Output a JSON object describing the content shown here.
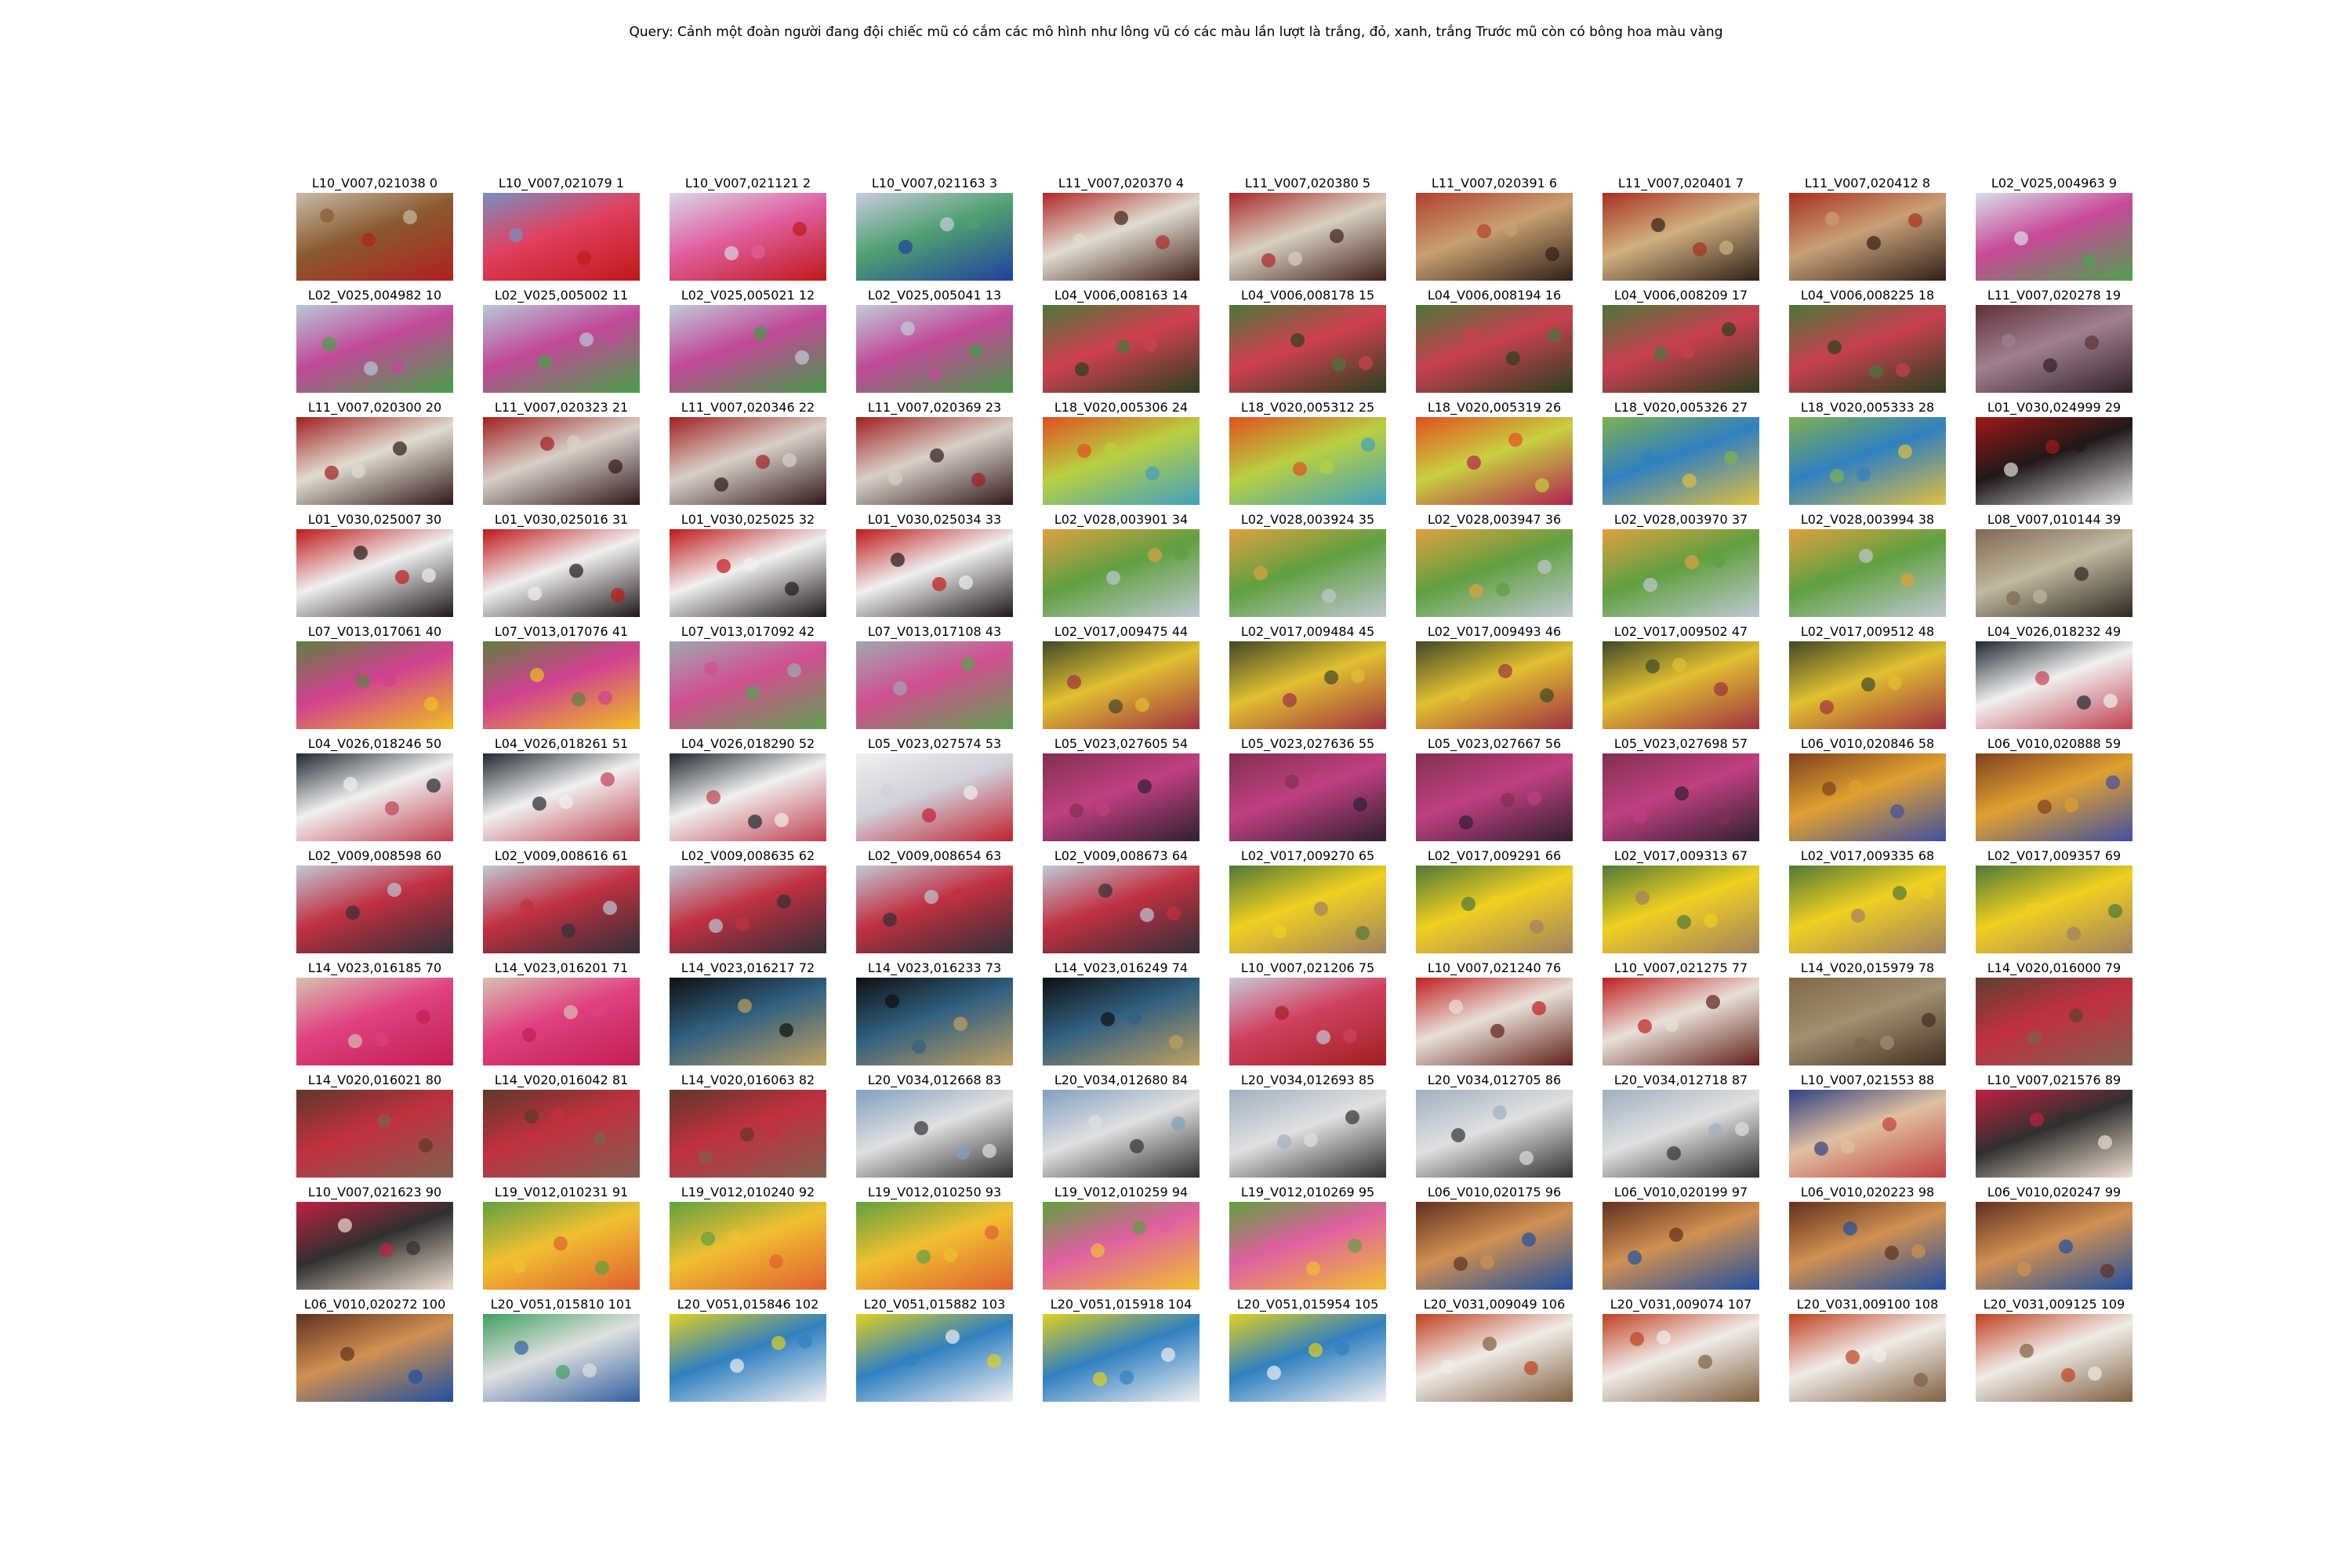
{
  "query": "Query: Cảnh một đoàn người đang đội chiếc mũ có cắm các mô hình như lông vũ có các màu lần lượt là trắng, đỏ, xanh, trắng Trước mũ còn có bông hoa màu vàng",
  "results": [
    {
      "label": "L10_V007,021038 0",
      "colors": [
        "#c8bca8",
        "#8a5a30",
        "#b02020"
      ]
    },
    {
      "label": "L10_V007,021079 1",
      "colors": [
        "#7890c0",
        "#e04060",
        "#c01818"
      ]
    },
    {
      "label": "L10_V007,021121 2",
      "colors": [
        "#d8d8e8",
        "#e060a0",
        "#c01818"
      ]
    },
    {
      "label": "L10_V007,021163 3",
      "colors": [
        "#c8cce0",
        "#50a070",
        "#2040a0"
      ]
    },
    {
      "label": "L11_V007,020370 4",
      "colors": [
        "#b02828",
        "#e0dcd0",
        "#402018"
      ]
    },
    {
      "label": "L11_V007,020380 5",
      "colors": [
        "#a82828",
        "#d8d0c0",
        "#402018"
      ]
    },
    {
      "label": "L11_V007,020391 6",
      "colors": [
        "#b04030",
        "#c8a070",
        "#302018"
      ]
    },
    {
      "label": "L11_V007,020401 7",
      "colors": [
        "#a83020",
        "#d0b080",
        "#302018"
      ]
    },
    {
      "label": "L11_V007,020412 8",
      "colors": [
        "#a83020",
        "#c8a078",
        "#302018"
      ]
    },
    {
      "label": "L02_V025,004963 9",
      "colors": [
        "#d8e0e8",
        "#c84898",
        "#50a050"
      ]
    },
    {
      "label": "L02_V025,004982 10",
      "colors": [
        "#b8c8d8",
        "#c04898",
        "#48a048"
      ]
    },
    {
      "label": "L02_V025,005002 11",
      "colors": [
        "#b8c8d8",
        "#c04898",
        "#48a048"
      ]
    },
    {
      "label": "L02_V025,005021 12",
      "colors": [
        "#c0ccd8",
        "#c04898",
        "#489848"
      ]
    },
    {
      "label": "L02_V025,005041 13",
      "colors": [
        "#c0ccd8",
        "#c04898",
        "#489848"
      ]
    },
    {
      "label": "L04_V006,008163 14",
      "colors": [
        "#4a7838",
        "#d04050",
        "#2a4020"
      ]
    },
    {
      "label": "L04_V006,008178 15",
      "colors": [
        "#4a7838",
        "#d04050",
        "#2a4020"
      ]
    },
    {
      "label": "L04_V006,008194 16",
      "colors": [
        "#4a7838",
        "#c84050",
        "#2a4020"
      ]
    },
    {
      "label": "L04_V006,008209 17",
      "colors": [
        "#4a7838",
        "#c84050",
        "#2a4020"
      ]
    },
    {
      "label": "L04_V006,008225 18",
      "colors": [
        "#4a7838",
        "#c84050",
        "#2a4020"
      ]
    },
    {
      "label": "L11_V007,020278 19",
      "colors": [
        "#603038",
        "#a08090",
        "#302028"
      ]
    },
    {
      "label": "L11_V007,020300 20",
      "colors": [
        "#a02020",
        "#e0dcd0",
        "#301818"
      ]
    },
    {
      "label": "L11_V007,020323 21",
      "colors": [
        "#a02020",
        "#d8d0c8",
        "#301818"
      ]
    },
    {
      "label": "L11_V007,020346 22",
      "colors": [
        "#a02020",
        "#d8d0c8",
        "#301818"
      ]
    },
    {
      "label": "L11_V007,020369 23",
      "colors": [
        "#a02020",
        "#d8d0c8",
        "#301818"
      ]
    },
    {
      "label": "L18_V020,005306 24",
      "colors": [
        "#e05020",
        "#b8d040",
        "#40a0c0"
      ]
    },
    {
      "label": "L18_V020,005312 25",
      "colors": [
        "#e05020",
        "#b8d040",
        "#40a0c0"
      ]
    },
    {
      "label": "L18_V020,005319 26",
      "colors": [
        "#e05020",
        "#c8d040",
        "#b02050"
      ]
    },
    {
      "label": "L18_V020,005326 27",
      "colors": [
        "#80b050",
        "#3080c0",
        "#e0c040"
      ]
    },
    {
      "label": "L18_V020,005333 28",
      "colors": [
        "#80b050",
        "#3080c0",
        "#e0c040"
      ]
    },
    {
      "label": "L01_V030,024999 29",
      "colors": [
        "#a01818",
        "#201818",
        "#e0e0e0"
      ]
    },
    {
      "label": "L01_V030,025007 30",
      "colors": [
        "#c01818",
        "#f0f0f0",
        "#201818"
      ]
    },
    {
      "label": "L01_V030,025016 31",
      "colors": [
        "#c01818",
        "#f0f0f0",
        "#201818"
      ]
    },
    {
      "label": "L01_V030,025025 32",
      "colors": [
        "#c01818",
        "#f0f0f0",
        "#201818"
      ]
    },
    {
      "label": "L01_V030,025034 33",
      "colors": [
        "#c01818",
        "#f0f0f0",
        "#201818"
      ]
    },
    {
      "label": "L02_V028,003901 34",
      "colors": [
        "#e0a040",
        "#60a040",
        "#c0c8d0"
      ]
    },
    {
      "label": "L02_V028,003924 35",
      "colors": [
        "#e0a040",
        "#60a040",
        "#c0c8d0"
      ]
    },
    {
      "label": "L02_V028,003947 36",
      "colors": [
        "#e0a040",
        "#60a040",
        "#c0c8d0"
      ]
    },
    {
      "label": "L02_V028,003970 37",
      "colors": [
        "#e0a040",
        "#60a040",
        "#c0c8d0"
      ]
    },
    {
      "label": "L02_V028,003994 38",
      "colors": [
        "#e0a040",
        "#60a040",
        "#c0c8d0"
      ]
    },
    {
      "label": "L08_V007,010144 39",
      "colors": [
        "#806850",
        "#c0b8a0",
        "#302820"
      ]
    },
    {
      "label": "L07_V013,017061 40",
      "colors": [
        "#608040",
        "#d04090",
        "#f0c020"
      ]
    },
    {
      "label": "L07_V013,017076 41",
      "colors": [
        "#608040",
        "#d04090",
        "#f0c020"
      ]
    },
    {
      "label": "L07_V013,017092 42",
      "colors": [
        "#a0a8b0",
        "#d05090",
        "#60a050"
      ]
    },
    {
      "label": "L07_V013,017108 43",
      "colors": [
        "#a0a8b0",
        "#d05090",
        "#60a050"
      ]
    },
    {
      "label": "L02_V017,009475 44",
      "colors": [
        "#404828",
        "#e0c030",
        "#a03040"
      ]
    },
    {
      "label": "L02_V017,009484 45",
      "colors": [
        "#404828",
        "#e0c030",
        "#a03040"
      ]
    },
    {
      "label": "L02_V017,009493 46",
      "colors": [
        "#404828",
        "#e0c030",
        "#a03040"
      ]
    },
    {
      "label": "L02_V017,009502 47",
      "colors": [
        "#404828",
        "#e0c030",
        "#a03040"
      ]
    },
    {
      "label": "L02_V017,009512 48",
      "colors": [
        "#404828",
        "#e0c030",
        "#a03040"
      ]
    },
    {
      "label": "L04_V026,018232 49",
      "colors": [
        "#202830",
        "#f0f0f0",
        "#c04050"
      ]
    },
    {
      "label": "L04_V026,018246 50",
      "colors": [
        "#202830",
        "#f0f0f0",
        "#c04050"
      ]
    },
    {
      "label": "L04_V026,018261 51",
      "colors": [
        "#202830",
        "#f0f0f0",
        "#c04050"
      ]
    },
    {
      "label": "L04_V026,018290 52",
      "colors": [
        "#202830",
        "#f0f0f0",
        "#c04050"
      ]
    },
    {
      "label": "L05_V023,027574 53",
      "colors": [
        "#f0f0f0",
        "#d0d0d8",
        "#c02030"
      ]
    },
    {
      "label": "L05_V023,027605 54",
      "colors": [
        "#803050",
        "#c04080",
        "#302030"
      ]
    },
    {
      "label": "L05_V023,027636 55",
      "colors": [
        "#803050",
        "#c04080",
        "#302030"
      ]
    },
    {
      "label": "L05_V023,027667 56",
      "colors": [
        "#803050",
        "#c04080",
        "#302030"
      ]
    },
    {
      "label": "L05_V023,027698 57",
      "colors": [
        "#803050",
        "#c04080",
        "#302030"
      ]
    },
    {
      "label": "L06_V010,020846 58",
      "colors": [
        "#804020",
        "#e0a030",
        "#4050a0"
      ]
    },
    {
      "label": "L06_V010,020888 59",
      "colors": [
        "#804020",
        "#e0a030",
        "#4050a0"
      ]
    },
    {
      "label": "L02_V009,008598 60",
      "colors": [
        "#c0c8d8",
        "#c03040",
        "#303038"
      ]
    },
    {
      "label": "L02_V009,008616 61",
      "colors": [
        "#c0c8d8",
        "#c03040",
        "#303038"
      ]
    },
    {
      "label": "L02_V009,008635 62",
      "colors": [
        "#c0c8d8",
        "#c03040",
        "#303038"
      ]
    },
    {
      "label": "L02_V009,008654 63",
      "colors": [
        "#c0c8d8",
        "#c03040",
        "#303038"
      ]
    },
    {
      "label": "L02_V009,008673 64",
      "colors": [
        "#c0c8d8",
        "#c03040",
        "#303038"
      ]
    },
    {
      "label": "L02_V017,009270 65",
      "colors": [
        "#507838",
        "#f0d020",
        "#a08060"
      ]
    },
    {
      "label": "L02_V017,009291 66",
      "colors": [
        "#507838",
        "#f0d020",
        "#a08060"
      ]
    },
    {
      "label": "L02_V017,009313 67",
      "colors": [
        "#507838",
        "#f0d020",
        "#a08060"
      ]
    },
    {
      "label": "L02_V017,009335 68",
      "colors": [
        "#507838",
        "#f0d020",
        "#a08060"
      ]
    },
    {
      "label": "L02_V017,009357 69",
      "colors": [
        "#507838",
        "#f0d020",
        "#a08060"
      ]
    },
    {
      "label": "L14_V023,016185 70",
      "colors": [
        "#d8c0b0",
        "#e04080",
        "#c02050"
      ]
    },
    {
      "label": "L14_V023,016201 71",
      "colors": [
        "#d8c0b0",
        "#e04080",
        "#c02050"
      ]
    },
    {
      "label": "L14_V023,016217 72",
      "colors": [
        "#101010",
        "#306080",
        "#c0a060"
      ]
    },
    {
      "label": "L14_V023,016233 73",
      "colors": [
        "#101010",
        "#306080",
        "#c0a060"
      ]
    },
    {
      "label": "L14_V023,016249 74",
      "colors": [
        "#101010",
        "#306080",
        "#c0a060"
      ]
    },
    {
      "label": "L10_V007,021206 75",
      "colors": [
        "#c8c8d8",
        "#d04060",
        "#a02020"
      ]
    },
    {
      "label": "L10_V007,021240 76",
      "colors": [
        "#c02020",
        "#e8e0d8",
        "#602018"
      ]
    },
    {
      "label": "L10_V007,021275 77",
      "colors": [
        "#c02020",
        "#e8e0d8",
        "#602018"
      ]
    },
    {
      "label": "L14_V020,015979 78",
      "colors": [
        "#806848",
        "#a09070",
        "#403020"
      ]
    },
    {
      "label": "L14_V020,016000 79",
      "colors": [
        "#604030",
        "#c03040",
        "#806050"
      ]
    },
    {
      "label": "L14_V020,016021 80",
      "colors": [
        "#603828",
        "#c03040",
        "#806050"
      ]
    },
    {
      "label": "L14_V020,016042 81",
      "colors": [
        "#603828",
        "#c03040",
        "#806050"
      ]
    },
    {
      "label": "L14_V020,016063 82",
      "colors": [
        "#603828",
        "#c03040",
        "#806050"
      ]
    },
    {
      "label": "L20_V034,012668 83",
      "colors": [
        "#80a0c0",
        "#e0e0e0",
        "#303030"
      ]
    },
    {
      "label": "L20_V034,012680 84",
      "colors": [
        "#80a0c0",
        "#e0e0e0",
        "#303030"
      ]
    },
    {
      "label": "L20_V034,012693 85",
      "colors": [
        "#a0b0c0",
        "#e0e0e0",
        "#303030"
      ]
    },
    {
      "label": "L20_V034,012705 86",
      "colors": [
        "#a0b0c0",
        "#e0e0e0",
        "#303030"
      ]
    },
    {
      "label": "L20_V034,012718 87",
      "colors": [
        "#a0b0c0",
        "#e0e0e0",
        "#303030"
      ]
    },
    {
      "label": "L10_V007,021553 88",
      "colors": [
        "#304080",
        "#e0c0a0",
        "#c04040"
      ]
    },
    {
      "label": "L10_V007,021576 89",
      "colors": [
        "#c02040",
        "#303030",
        "#f0e0d0"
      ]
    },
    {
      "label": "L10_V007,021623 90",
      "colors": [
        "#c02040",
        "#303030",
        "#f0e0d0"
      ]
    },
    {
      "label": "L19_V012,010231 91",
      "colors": [
        "#60a040",
        "#f0c030",
        "#e06030"
      ]
    },
    {
      "label": "L19_V012,010240 92",
      "colors": [
        "#60a040",
        "#f0c030",
        "#e06030"
      ]
    },
    {
      "label": "L19_V012,010250 93",
      "colors": [
        "#60a040",
        "#f0c030",
        "#e06030"
      ]
    },
    {
      "label": "L19_V012,010259 94",
      "colors": [
        "#60a040",
        "#e060a0",
        "#f0c030"
      ]
    },
    {
      "label": "L19_V012,010269 95",
      "colors": [
        "#60a040",
        "#e060a0",
        "#f0c030"
      ]
    },
    {
      "label": "L06_V010,020175 96",
      "colors": [
        "#603020",
        "#d09050",
        "#2050a0"
      ]
    },
    {
      "label": "L06_V010,020199 97",
      "colors": [
        "#603020",
        "#d09050",
        "#2050a0"
      ]
    },
    {
      "label": "L06_V010,020223 98",
      "colors": [
        "#603020",
        "#d09050",
        "#2050a0"
      ]
    },
    {
      "label": "L06_V010,020247 99",
      "colors": [
        "#603020",
        "#d09050",
        "#2050a0"
      ]
    },
    {
      "label": "L06_V010,020272 100",
      "colors": [
        "#603020",
        "#d09050",
        "#2050a0"
      ]
    },
    {
      "label": "L20_V051,015810 101",
      "colors": [
        "#40a060",
        "#e0e0e0",
        "#3060a0"
      ]
    },
    {
      "label": "L20_V051,015846 102",
      "colors": [
        "#e0d020",
        "#3080c0",
        "#f0f0f0"
      ]
    },
    {
      "label": "L20_V051,015882 103",
      "colors": [
        "#e0d020",
        "#3080c0",
        "#f0f0f0"
      ]
    },
    {
      "label": "L20_V051,015918 104",
      "colors": [
        "#e0d020",
        "#3080c0",
        "#f0f0f0"
      ]
    },
    {
      "label": "L20_V051,015954 105",
      "colors": [
        "#e0d020",
        "#3080c0",
        "#f0f0f0"
      ]
    },
    {
      "label": "L20_V031,009049 106",
      "colors": [
        "#c04020",
        "#f0ece8",
        "#806040"
      ]
    },
    {
      "label": "L20_V031,009074 107",
      "colors": [
        "#c04020",
        "#f0ece8",
        "#806040"
      ]
    },
    {
      "label": "L20_V031,009100 108",
      "colors": [
        "#c04020",
        "#f0ece8",
        "#806040"
      ]
    },
    {
      "label": "L20_V031,009125 109",
      "colors": [
        "#c04020",
        "#f0ece8",
        "#806040"
      ]
    }
  ]
}
